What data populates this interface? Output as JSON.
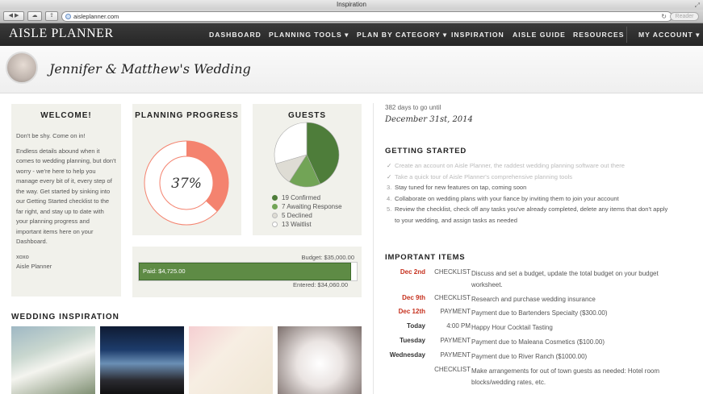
{
  "browser": {
    "window_title": "Inspiration",
    "url": "aisleplanner.com",
    "reader_label": "Reader"
  },
  "nav": {
    "logo": "AISLE PLANNER",
    "items": [
      "DASHBOARD",
      "PLANNING TOOLS ▾",
      "PLAN BY CATEGORY ▾",
      "INSPIRATION",
      "AISLE GUIDE",
      "RESOURCES"
    ],
    "account": "MY ACCOUNT ▾"
  },
  "header": {
    "title": "Jennifer & Matthew's Wedding"
  },
  "welcome": {
    "heading": "WELCOME!",
    "p1": "Don't be shy. Come on in!",
    "p2": "Endless details abound when it comes to wedding planning, but don't worry - we're here to help you manage every bit of it, every step of the way. Get started by sinking into our Getting Started checklist to the far right, and stay up to date with your planning progress and important items here on your Dashboard.",
    "sign1": "xoxo",
    "sign2": "Aisle Planner"
  },
  "progress": {
    "heading": "PLANNING PROGRESS",
    "value": 37,
    "label": "37%",
    "color": "#f4836f"
  },
  "guests": {
    "heading": "GUESTS",
    "items": [
      {
        "label": "19 Confirmed",
        "count": 19,
        "color": "#4e7d3a"
      },
      {
        "label": "7 Awaiting Response",
        "count": 7,
        "color": "#72a456"
      },
      {
        "label": "5 Declined",
        "count": 5,
        "color": "#dedcd4"
      },
      {
        "label": "13 Waitlist",
        "count": 13,
        "color": "#ffffff"
      }
    ]
  },
  "budget": {
    "budget_label": "Budget: $35,000.00",
    "paid_label": "Paid: $4,725.00",
    "entered_label": "Entered: $34,060.00",
    "entered_fraction": 0.973,
    "bar_color": "#5e8b45"
  },
  "inspiration": {
    "heading": "WEDDING INSPIRATION",
    "images": [
      "wedding-table-icon",
      "ceremony-icon",
      "invitation-icon",
      "flowers-icon"
    ]
  },
  "countdown": {
    "days": "382 days to go until",
    "date": "December 31st, 2014"
  },
  "getting_started": {
    "heading": "GETTING STARTED",
    "items": [
      {
        "mark": "✓",
        "text": "Create an account on Aisle Planner, the raddest wedding planning software out there",
        "done": true
      },
      {
        "mark": "✓",
        "text": "Take a quick tour of Aisle Planner's comprehensive planning tools",
        "done": true
      },
      {
        "mark": "3.",
        "text": "Stay tuned for new features on tap, coming soon",
        "done": false
      },
      {
        "mark": "4.",
        "text": "Collaborate on wedding plans with your fiance by inviting them to join your account",
        "done": false
      },
      {
        "mark": "5.",
        "text": "Review the checklist, check off any tasks you've already completed, delete any items that don't apply",
        "done": false
      },
      {
        "mark": "",
        "text": "to your wedding, and assign tasks as needed",
        "done": false
      }
    ]
  },
  "important": {
    "heading": "IMPORTANT ITEMS",
    "rows": [
      {
        "date": "Dec 2nd",
        "type": "CHECKLIST",
        "desc": "Discuss and set a budget, update the total budget on your budget worksheet.",
        "red": true
      },
      {
        "date": "Dec 9th",
        "type": "CHECKLIST",
        "desc": "Research and purchase wedding insurance",
        "red": true
      },
      {
        "date": "Dec 12th",
        "type": "PAYMENT",
        "desc": "Payment due to Bartenders Specialty ($300.00)",
        "red": true
      },
      {
        "date": "Today",
        "type": "4:00 PM",
        "desc": "Happy Hour Cocktail Tasting",
        "red": false
      },
      {
        "date": "Tuesday",
        "type": "PAYMENT",
        "desc": "Payment due to Maleana Cosmetics ($100.00)",
        "red": false
      },
      {
        "date": "Wednesday",
        "type": "PAYMENT",
        "desc": "Payment due to River Ranch ($1000.00)",
        "red": false
      },
      {
        "date": "",
        "type": "CHECKLIST",
        "desc": "Make arrangements for out of town guests as needed: Hotel room blocks/wedding rates, etc.",
        "red": false
      }
    ]
  }
}
